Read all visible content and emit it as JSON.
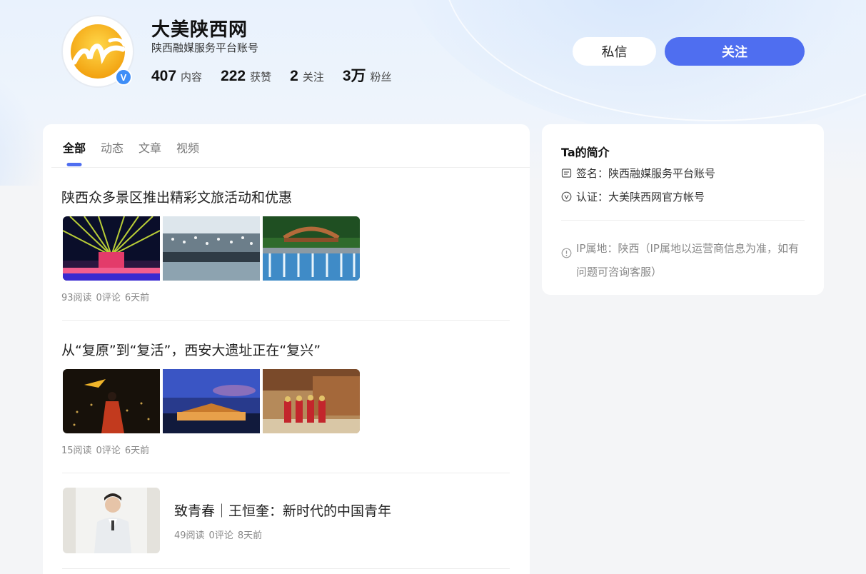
{
  "profile": {
    "name": "大美陕西网",
    "subtitle": "陕西融媒服务平台账号",
    "verified_mark": "V",
    "stats": [
      {
        "value": "407",
        "label": "内容"
      },
      {
        "value": "222",
        "label": "获赞"
      },
      {
        "value": "2",
        "label": "关注"
      },
      {
        "value": "3万",
        "label": "粉丝"
      }
    ],
    "message_button": "私信",
    "follow_button": "关注"
  },
  "tabs": [
    {
      "label": "全部",
      "active": true
    },
    {
      "label": "动态",
      "active": false
    },
    {
      "label": "文章",
      "active": false
    },
    {
      "label": "视频",
      "active": false
    }
  ],
  "articles": [
    {
      "title": "陕西众多景区推出精彩文旅活动和优惠",
      "reads": "93阅读",
      "comments": "0评论",
      "time": "6天前"
    },
    {
      "title": "从“复原”到“复活”，西安大遗址正在“复兴”",
      "reads": "15阅读",
      "comments": "0评论",
      "time": "6天前"
    },
    {
      "title": "致青春｜王恒奎：新时代的中国青年",
      "reads": "49阅读",
      "comments": "0评论",
      "time": "8天前"
    }
  ],
  "intro": {
    "title": "Ta的简介",
    "signature": "签名：陕西融媒服务平台账号",
    "certification": "认证：大美陕西网官方帐号",
    "ip_location": "IP属地：陕西（IP属地以运营商信息为准，如有问题可咨询客服）"
  },
  "colors": {
    "accent": "#4f6ef0",
    "verify_badge": "#3f8ef7",
    "logo_yellow": "#f5b81c"
  }
}
